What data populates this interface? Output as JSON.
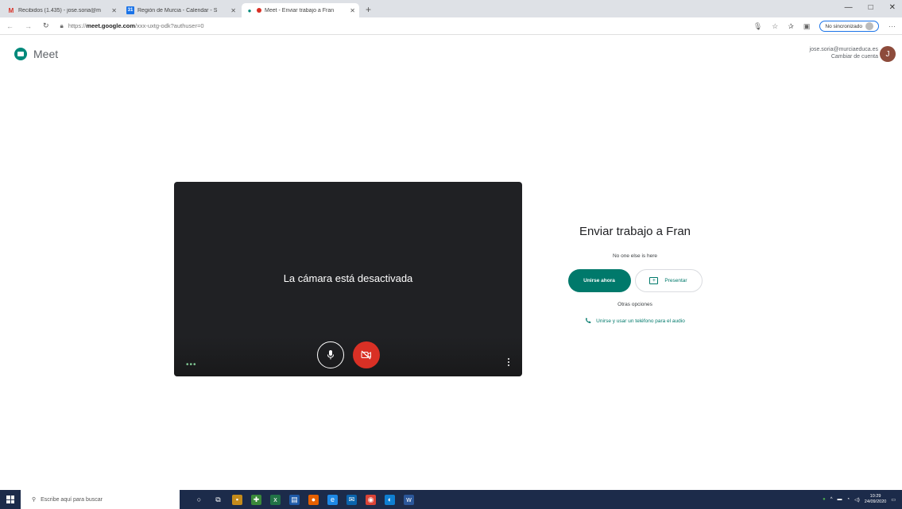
{
  "browser": {
    "tabs": [
      {
        "title": "Recibidos (1.435) - jose.soria@m",
        "icon": "gmail-icon",
        "active": false
      },
      {
        "title": "Región de Murcia - Calendar - S",
        "icon": "calendar-icon",
        "active": false
      },
      {
        "title": "Meet - Enviar trabajo a Fran",
        "icon": "meet-icon",
        "active": true
      }
    ],
    "address": {
      "prefix": "https://",
      "domain": "meet.google.com",
      "path": "/xxx-uxtg-odk?authuser=0"
    },
    "sync_label": "No sincronizado"
  },
  "meet": {
    "app_name": "Meet",
    "account_email": "jose.soria@murciaeduca.es",
    "switch_account": "Cambiar de cuenta",
    "avatar_initial": "J",
    "camera_off_message": "La cámara está desactivada",
    "meeting_title": "Enviar trabajo a Fran",
    "no_one_here": "No one else is here",
    "join_now": "Unirse ahora",
    "present": "Presentar",
    "other_options": "Otras opciones",
    "join_phone": "Unirse y usar un teléfono para el audio"
  },
  "taskbar": {
    "search_placeholder": "Escribe aquí para buscar",
    "time": "10:29",
    "date": "24/09/2020"
  },
  "colors": {
    "accent": "#00796b",
    "mic_off": "#d93025",
    "taskbar": "#1c2b4a"
  }
}
